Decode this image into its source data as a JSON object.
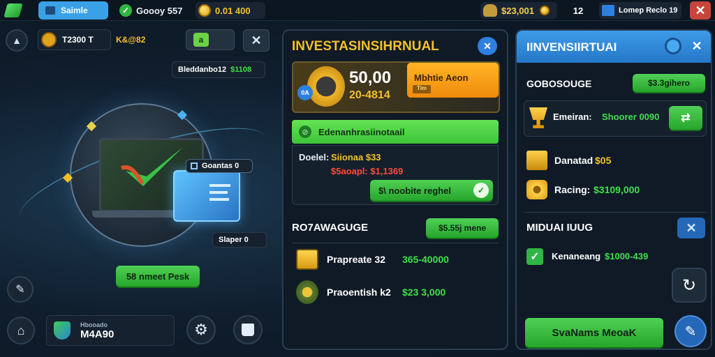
{
  "topbar": {
    "tab_label": "Saimle",
    "stat1": "Goooy 557",
    "stat2": "0.01 400",
    "coins": "$23,001",
    "level": "12",
    "profile": "Lomep Reclo 19"
  },
  "left": {
    "player_name": "T2300 T",
    "player_tag": "K&@82",
    "mini_btn": "a",
    "balance_label": "Bleddanbo12",
    "balance_value": "$1108",
    "callout_top": "Goantas 0",
    "callout_bottom": "Slaper 0",
    "start_button": "58 nmeet Pesk",
    "profile_title": "Hbooado",
    "profile_value": "M4A90"
  },
  "middle": {
    "title": "INVESTASINSIHRNUAL",
    "feature_value": "50,00",
    "feature_sub": "20-4814",
    "badge": "0A",
    "promo_title": "Mbhtie Aeon",
    "promo_sub": "Tim",
    "green_bar": "Edenanhrasiinotaail",
    "deal_label": "Doelel:",
    "deal_value": "Siionaa $33",
    "deal_red": "$5aoapl: $1,1369",
    "deal_button": "$\\ noobite reghel",
    "section_title": "RO7AWAGUGE",
    "section_button": "$5.55j mene",
    "rows": [
      {
        "name": "Prapreate 32",
        "value": "365-40000"
      },
      {
        "name": "Praoentish k2",
        "value": "$23 3,000"
      }
    ]
  },
  "right": {
    "title": "IINVENSIIRTUAI",
    "sub_title": "GOBOSOUGE",
    "sub_button": "$3.3gihero",
    "rows": [
      {
        "label": "Emeiran:",
        "value": "Shoorer 0090"
      },
      {
        "label": "Danatad",
        "value": "$05"
      },
      {
        "label": "Racing:",
        "value": "$3109,000"
      }
    ],
    "section2": "MIDUAI IUUG",
    "check_label": "Kenaneang",
    "check_value": "$1000-439",
    "big_button": "SvaNams MeoaK"
  },
  "colors": {
    "accent_green": "#3fd44a",
    "accent_blue": "#2d7fe0",
    "gold": "#f4c02a",
    "danger": "#d9463a"
  }
}
